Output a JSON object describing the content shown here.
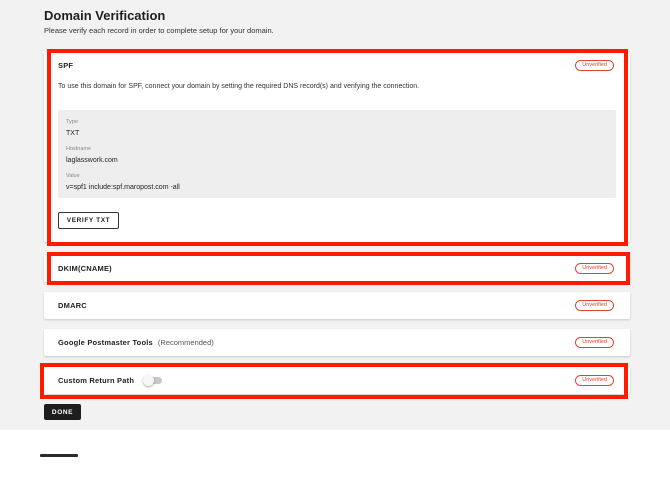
{
  "page": {
    "title": "Domain Verification",
    "subtitle": "Please verify each record in order to complete setup for your domain."
  },
  "spf": {
    "title": "SPF",
    "status": "Unverified",
    "description": "To use this domain for SPF, connect your domain by setting the required DNS record(s) and verifying the connection.",
    "fields": [
      {
        "label": "Type",
        "value": "TXT"
      },
      {
        "label": "Hostname",
        "value": "laglasswork.com"
      },
      {
        "label": "Value",
        "value": "v=spf1 include:spf.maropost.com -all"
      }
    ],
    "verify_label": "VERIFY TXT"
  },
  "dkim": {
    "title": "DKIM(CNAME)",
    "status": "Unverified"
  },
  "dmarc": {
    "title": "DMARC",
    "status": "Unverified"
  },
  "postmaster": {
    "title": "Google Postmaster Tools",
    "note": "(Recommended)",
    "status": "Unverified"
  },
  "return_path": {
    "title": "Custom Return Path",
    "status": "Unverified",
    "enabled": false
  },
  "done_label": "DONE",
  "colors": {
    "accent_highlight": "#ff1a00",
    "status_unverified": "#e0452c",
    "primary_button": "#1e1e1e"
  }
}
